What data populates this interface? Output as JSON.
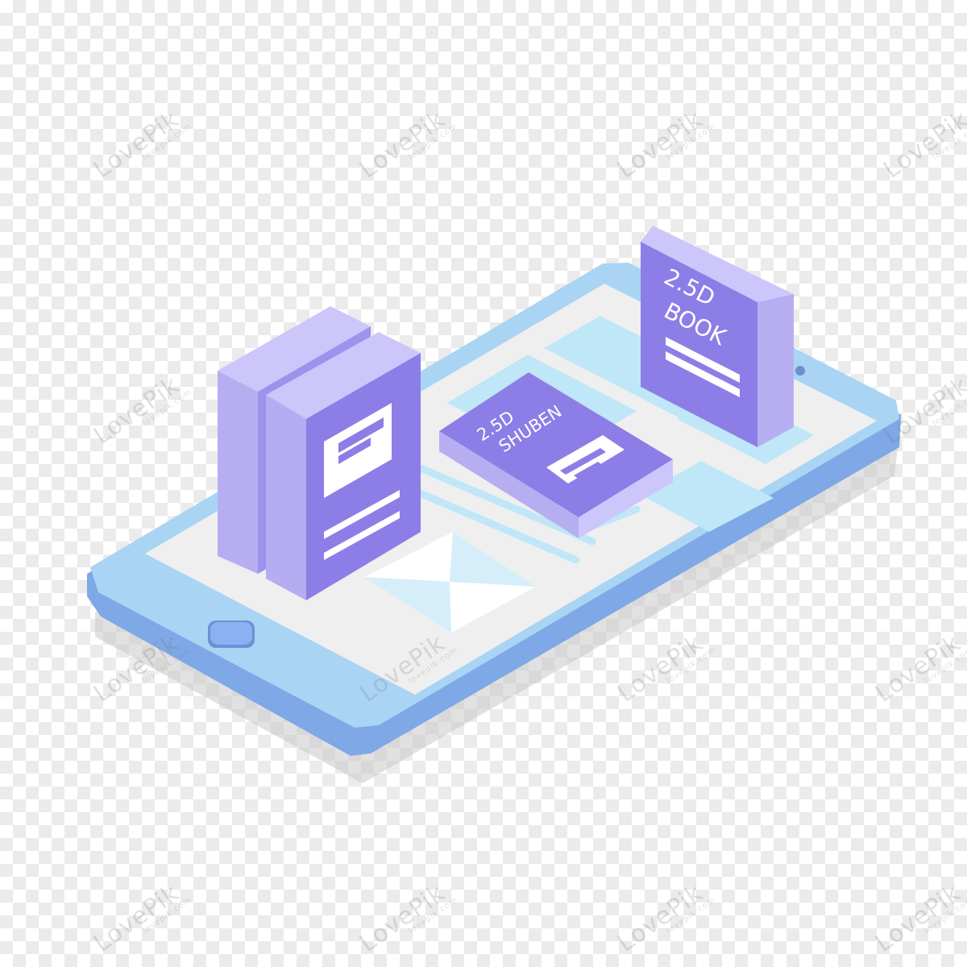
{
  "illustration": {
    "book_right": {
      "title_line1": "2.5D",
      "title_line2": "BOOK"
    },
    "book_lying": {
      "title_line1": "2.5D",
      "title_line2": "SHUBEN"
    }
  },
  "watermark": {
    "brand": "LovePik",
    "site": "lovepik.com"
  },
  "colors": {
    "phone_body": "#a9d5f5",
    "phone_edge": "#7aa5e6",
    "screen": "#efefef",
    "tile": "#bfe7f7",
    "book_cover": "#8c7ee6",
    "book_spine": "#b9b1f3",
    "home_button": "#87aef0"
  }
}
